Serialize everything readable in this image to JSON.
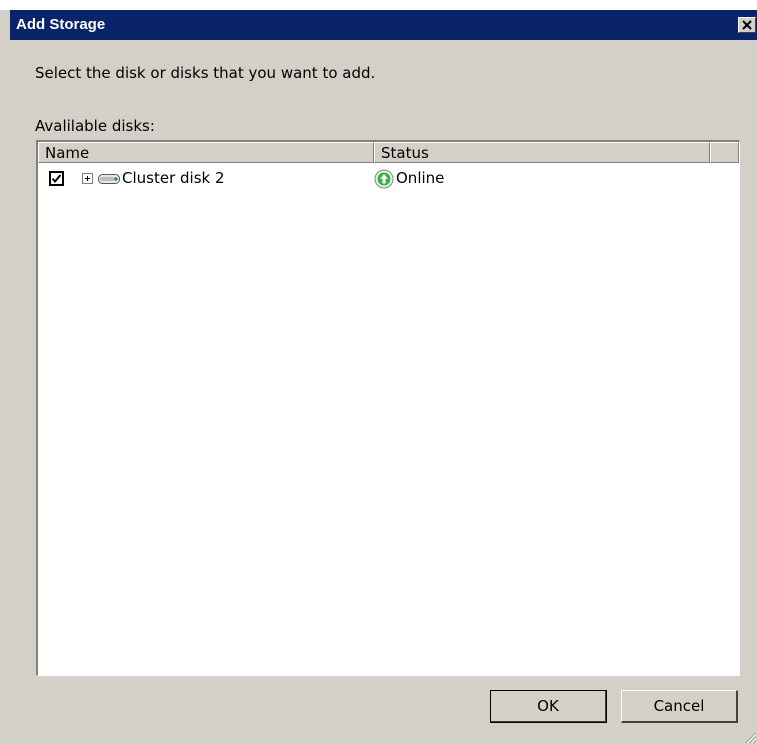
{
  "window": {
    "title": "Add Storage",
    "close_icon": "close-icon"
  },
  "instruction": "Select the disk or disks that you want to add.",
  "available_label": "Avalilable disks:",
  "table": {
    "columns": [
      "Name",
      "Status"
    ],
    "rows": [
      {
        "checked": true,
        "expandable": true,
        "icon": "disk-icon",
        "name": "Cluster disk 2",
        "status_icon": "online-arrow-icon",
        "status": "Online"
      }
    ]
  },
  "buttons": {
    "ok": "OK",
    "cancel": "Cancel"
  },
  "colors": {
    "titlebar": "#0a246a",
    "window_bg": "#d4d0c8",
    "online_green": "#3cb044"
  }
}
